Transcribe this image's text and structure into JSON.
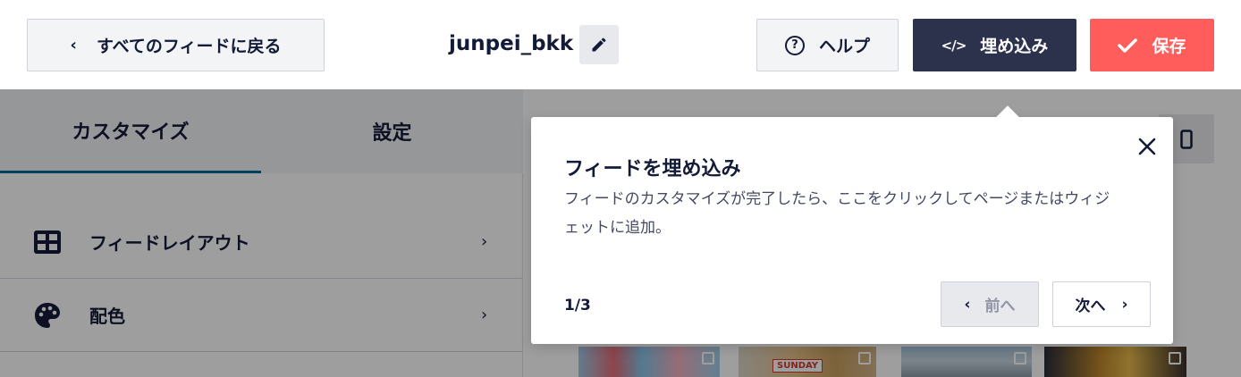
{
  "header": {
    "back_label": "すべてのフィードに戻る",
    "feed_name": "junpei_bkk",
    "help_label": "ヘルプ",
    "embed_label": "埋め込み",
    "save_label": "保存"
  },
  "sidebar": {
    "tabs": [
      {
        "label": "カスタマイズ",
        "active": true
      },
      {
        "label": "設定",
        "active": false
      }
    ],
    "items": [
      {
        "label": "フィードレイアウト",
        "icon": "layout-grid-icon"
      },
      {
        "label": "配色",
        "icon": "palette-icon"
      }
    ]
  },
  "preview": {
    "thumbnail_sign": "SUNDAY"
  },
  "popover": {
    "title": "フィードを埋め込み",
    "description": "フィードのカスタマイズが完了したら、ここをクリックしてページまたはウィジェットに追加。",
    "step": "1/3",
    "prev_label": "前へ",
    "next_label": "次へ"
  },
  "colors": {
    "accent_dark": "#2c324c",
    "save_red": "#ff5c5c",
    "active_tab_underline": "#0068a0"
  }
}
